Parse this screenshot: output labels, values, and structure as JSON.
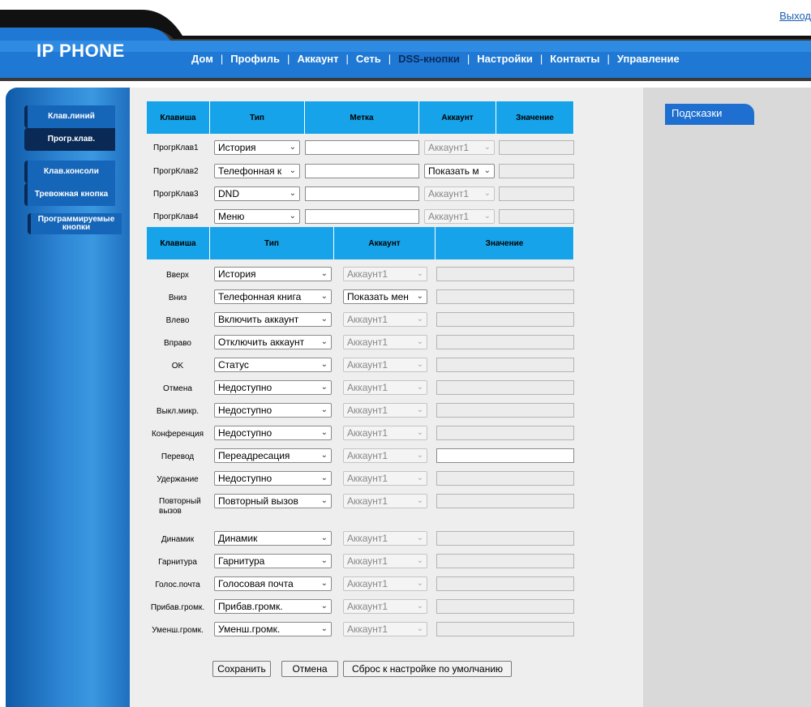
{
  "header": {
    "logo": "IP PHONE",
    "logout": "Выход",
    "nav": [
      {
        "label": "Дом"
      },
      {
        "label": "Профиль"
      },
      {
        "label": "Аккаунт"
      },
      {
        "label": "Сеть"
      },
      {
        "label": "DSS-кнопки",
        "active": true
      },
      {
        "label": "Настройки"
      },
      {
        "label": "Контакты"
      },
      {
        "label": "Управление"
      }
    ]
  },
  "sidebar": {
    "items": [
      {
        "label": "Клав.линий"
      },
      {
        "label": "Прогр.клав.",
        "active": true
      },
      {
        "label": "Клав.консоли"
      },
      {
        "label": "Тревожная кнопка"
      },
      {
        "label": "Программируемые кнопки"
      }
    ]
  },
  "hints": {
    "label": "Подсказки"
  },
  "softkeys": {
    "headers": [
      "Клавиша",
      "Тип",
      "Метка",
      "Аккаунт",
      "Значение"
    ],
    "rows": [
      {
        "key": "ПрогрКлав1",
        "type": "История",
        "label": "",
        "account": "Аккаунт1",
        "account_enabled": false,
        "value": "",
        "value_enabled": false
      },
      {
        "key": "ПрогрКлав2",
        "type": "Телефонная к",
        "label": "",
        "account": "Показать м",
        "account_enabled": true,
        "value": "",
        "value_enabled": false
      },
      {
        "key": "ПрогрКлав3",
        "type": "DND",
        "label": "",
        "account": "Аккаунт1",
        "account_enabled": false,
        "value": "",
        "value_enabled": false
      },
      {
        "key": "ПрогрКлав4",
        "type": "Меню",
        "label": "",
        "account": "Аккаунт1",
        "account_enabled": false,
        "value": "",
        "value_enabled": false
      }
    ]
  },
  "navkeys": {
    "headers": [
      "Клавиша",
      "Тип",
      "Аккаунт",
      "Значение"
    ],
    "rows": [
      {
        "key": "Вверх",
        "type": "История",
        "account": "Аккаунт1",
        "account_enabled": false,
        "value_enabled": false
      },
      {
        "key": "Вниз",
        "type": "Телефонная книга",
        "account": "Показать мен",
        "account_enabled": true,
        "value_enabled": false
      },
      {
        "key": "Влево",
        "type": "Включить аккаунт",
        "account": "Аккаунт1",
        "account_enabled": false,
        "value_enabled": false
      },
      {
        "key": "Вправо",
        "type": "Отключить аккаунт",
        "account": "Аккаунт1",
        "account_enabled": false,
        "value_enabled": false
      },
      {
        "key": "OK",
        "type": "Статус",
        "account": "Аккаунт1",
        "account_enabled": false,
        "value_enabled": false
      },
      {
        "key": "Отмена",
        "type": "Недоступно",
        "account": "Аккаунт1",
        "account_enabled": false,
        "value_enabled": false
      },
      {
        "key": "Выкл.микр.",
        "type": "Недоступно",
        "account": "Аккаунт1",
        "account_enabled": false,
        "value_enabled": false
      },
      {
        "key": "Конференция",
        "type": "Недоступно",
        "account": "Аккаунт1",
        "account_enabled": false,
        "value_enabled": false
      },
      {
        "key": "Перевод",
        "type": "Переадресация",
        "account": "Аккаунт1",
        "account_enabled": false,
        "value_enabled": true
      },
      {
        "key": "Удержание",
        "type": "Недоступно",
        "account": "Аккаунт1",
        "account_enabled": false,
        "value_enabled": false
      },
      {
        "key": "Повторный вызов",
        "type": "Повторный вызов",
        "account": "Аккаунт1",
        "account_enabled": false,
        "value_enabled": false
      },
      {
        "key": "Динамик",
        "type": "Динамик",
        "account": "Аккаунт1",
        "account_enabled": false,
        "value_enabled": false
      },
      {
        "key": "Гарнитура",
        "type": "Гарнитура",
        "account": "Аккаунт1",
        "account_enabled": false,
        "value_enabled": false
      },
      {
        "key": "Голос.почта",
        "type": "Голосовая почта",
        "account": "Аккаунт1",
        "account_enabled": false,
        "value_enabled": false
      },
      {
        "key": "Прибав.громк.",
        "type": "Прибав.громк.",
        "account": "Аккаунт1",
        "account_enabled": false,
        "value_enabled": false
      },
      {
        "key": "Уменш.громк.",
        "type": "Уменш.громк.",
        "account": "Аккаунт1",
        "account_enabled": false,
        "value_enabled": false
      }
    ]
  },
  "buttons": {
    "save": "Сохранить",
    "cancel": "Отмена",
    "reset": "Сброс к настройке по умолчанию"
  }
}
